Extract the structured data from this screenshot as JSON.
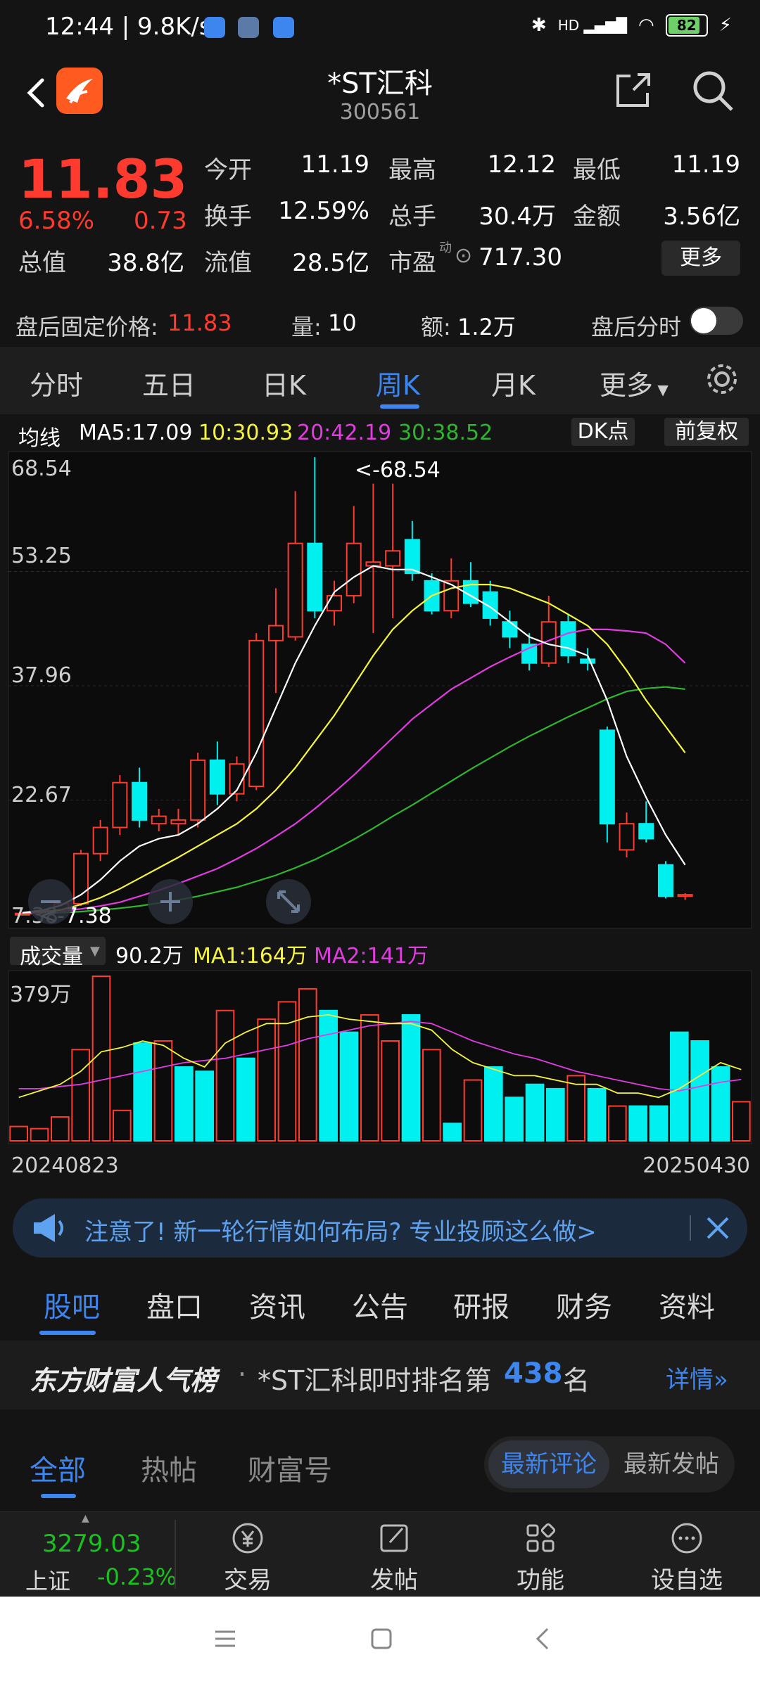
{
  "status": {
    "time": "12:44 | 9.8K/s",
    "battery": "82",
    "net": "HD"
  },
  "header": {
    "title": "*ST汇科",
    "code": "300561"
  },
  "quote": {
    "price": "11.83",
    "pct": "6.58%",
    "change": "0.73",
    "open_label": "今开",
    "open": "11.19",
    "high_label": "最高",
    "high": "12.12",
    "low_label": "最低",
    "low": "11.19",
    "turnover_label": "换手",
    "turnover": "12.59%",
    "vol_label": "总手",
    "vol": "30.4万",
    "amount_label": "金额",
    "amount": "3.56亿",
    "mktcap_label": "总值",
    "mktcap": "38.8亿",
    "float_label": "流值",
    "float": "28.5亿",
    "pe_label": "市盈",
    "pe_sup": "动",
    "pe": "717.30",
    "more": "更多",
    "after_label": "盘后固定价格:",
    "after_price": "11.83",
    "after_vol_label": "量:",
    "after_vol": "10",
    "after_amt_label": "额:",
    "after_amt": "1.2万",
    "after_toggle_label": "盘后分时"
  },
  "period_tabs": [
    "分时",
    "五日",
    "日K",
    "周K",
    "月K",
    "更多"
  ],
  "ma": {
    "label": "均线",
    "ma5": "MA5:17.09",
    "ma10": "10:30.93",
    "ma20": "20:42.19",
    "ma30": "30:38.52",
    "dk": "DK点",
    "adj": "前复权"
  },
  "axis": {
    "y": [
      "68.54",
      "53.25",
      "37.96",
      "22.67",
      "7.38"
    ],
    "max_ann": "<-68.54",
    "min_ann": "<-7.38",
    "vol_max": "379万"
  },
  "volume": {
    "label": "成交量",
    "value": "90.2万",
    "ma1": "MA1:164万",
    "ma2": "MA2:141万"
  },
  "dates": {
    "start": "20240823",
    "end": "20250430"
  },
  "banner": {
    "text": "注意了! 新一轮行情如何布局? 专业投顾这么做>"
  },
  "content_tabs": [
    "股吧",
    "盘口",
    "资讯",
    "公告",
    "研报",
    "财务",
    "资料"
  ],
  "rank": {
    "brand": "东方财富人气榜",
    "text": "*ST汇科即时排名第",
    "num": "438",
    "suffix": "名",
    "detail": "详情"
  },
  "sub_tabs": [
    "全部",
    "热帖",
    "财富号"
  ],
  "sort": {
    "on": "最新评论",
    "off": "最新发帖"
  },
  "bottom": {
    "index_value": "3279.03",
    "index_name": "上证",
    "index_change": "-0.23%",
    "trade": "交易",
    "post": "发帖",
    "func": "功能",
    "watch": "设自选"
  },
  "colors": {
    "up": "#ff3b30",
    "down": "#00f0f0",
    "accent": "#3d86f0",
    "ma5": "#ffffff",
    "ma10": "#f5f53c",
    "ma20": "#e03ce0",
    "ma30": "#2fb52f"
  },
  "chart_data": {
    "type": "candlestick",
    "ylim": [
      7.38,
      68.54
    ],
    "candles": [
      {
        "o": 7.4,
        "h": 7.6,
        "l": 7.38,
        "c": 7.5
      },
      {
        "o": 7.5,
        "h": 8.0,
        "l": 7.4,
        "c": 7.9
      },
      {
        "o": 7.9,
        "h": 9.0,
        "l": 7.7,
        "c": 8.8
      },
      {
        "o": 8.8,
        "h": 16.0,
        "l": 8.5,
        "c": 15.5
      },
      {
        "o": 15.5,
        "h": 20.0,
        "l": 14.5,
        "c": 19.0
      },
      {
        "o": 19.0,
        "h": 26.0,
        "l": 18.0,
        "c": 25.0
      },
      {
        "o": 25.0,
        "h": 27.0,
        "l": 19.0,
        "c": 20.0
      },
      {
        "o": 19.5,
        "h": 21.5,
        "l": 18.5,
        "c": 20.5
      },
      {
        "o": 19.5,
        "h": 21.5,
        "l": 18.0,
        "c": 20.0
      },
      {
        "o": 20.0,
        "h": 29.0,
        "l": 19.0,
        "c": 28.0
      },
      {
        "o": 28.0,
        "h": 30.5,
        "l": 22.0,
        "c": 23.5
      },
      {
        "o": 23.5,
        "h": 28.5,
        "l": 22.5,
        "c": 27.5
      },
      {
        "o": 24.5,
        "h": 45.0,
        "l": 24.0,
        "c": 44.0
      },
      {
        "o": 44.0,
        "h": 51.0,
        "l": 37.0,
        "c": 46.0
      },
      {
        "o": 44.5,
        "h": 64.0,
        "l": 44.0,
        "c": 57.0
      },
      {
        "o": 57.0,
        "h": 68.54,
        "l": 47.0,
        "c": 48.0
      },
      {
        "o": 48.0,
        "h": 52.0,
        "l": 46.0,
        "c": 50.0
      },
      {
        "o": 50.0,
        "h": 62.0,
        "l": 49.0,
        "c": 57.0
      },
      {
        "o": 54.0,
        "h": 65.0,
        "l": 45.0,
        "c": 54.5
      },
      {
        "o": 54.0,
        "h": 65.0,
        "l": 47.0,
        "c": 56.0
      },
      {
        "o": 57.5,
        "h": 60.0,
        "l": 52.0,
        "c": 53.0
      },
      {
        "o": 52.0,
        "h": 53.0,
        "l": 47.5,
        "c": 48.0
      },
      {
        "o": 48.0,
        "h": 55.0,
        "l": 47.0,
        "c": 52.0
      },
      {
        "o": 52.0,
        "h": 54.5,
        "l": 48.5,
        "c": 49.0
      },
      {
        "o": 50.5,
        "h": 52.0,
        "l": 46.0,
        "c": 47.0
      },
      {
        "o": 46.5,
        "h": 48.0,
        "l": 43.0,
        "c": 44.5
      },
      {
        "o": 43.5,
        "h": 45.0,
        "l": 40.0,
        "c": 41.0
      },
      {
        "o": 41.0,
        "h": 50.0,
        "l": 40.5,
        "c": 46.5
      },
      {
        "o": 46.5,
        "h": 47.5,
        "l": 41.0,
        "c": 42.0
      },
      {
        "o": 41.5,
        "h": 43.0,
        "l": 40.0,
        "c": 41.0
      },
      {
        "o": 32.0,
        "h": 32.5,
        "l": 17.0,
        "c": 19.5
      },
      {
        "o": 16.0,
        "h": 21.0,
        "l": 15.0,
        "c": 19.5
      },
      {
        "o": 19.5,
        "h": 22.5,
        "l": 17.0,
        "c": 17.5
      },
      {
        "o": 14.0,
        "h": 14.5,
        "l": 9.5,
        "c": 9.8
      },
      {
        "o": 9.8,
        "h": 10.2,
        "l": 9.3,
        "c": 10.0
      }
    ],
    "ma5": [
      7.6,
      7.9,
      8.6,
      10.0,
      12.0,
      14.5,
      16.5,
      17.5,
      18.0,
      19.5,
      21.5,
      24.0,
      29.0,
      35.0,
      41.0,
      46.0,
      50.5,
      52.5,
      54.0,
      53.5,
      53.5,
      52.5,
      51.5,
      50.0,
      48.5,
      46.5,
      44.5,
      43.5,
      43.0,
      42.0,
      36.0,
      28.5,
      23.0,
      18.0,
      14.0
    ],
    "ma10": [
      7.6,
      7.7,
      8.0,
      8.7,
      9.6,
      10.8,
      12.2,
      13.6,
      15.0,
      16.5,
      18.0,
      19.5,
      21.5,
      24.0,
      27.0,
      30.5,
      34.0,
      38.0,
      42.0,
      45.5,
      48.0,
      50.0,
      51.0,
      51.5,
      51.5,
      51.0,
      50.0,
      49.0,
      47.5,
      46.0,
      43.5,
      40.0,
      36.0,
      32.5,
      29.0
    ],
    "ma20": [
      7.5,
      7.6,
      7.8,
      8.1,
      8.5,
      9.0,
      9.8,
      10.6,
      11.5,
      12.5,
      13.5,
      14.8,
      16.2,
      17.8,
      19.5,
      21.5,
      23.7,
      26.0,
      28.5,
      31.0,
      33.5,
      35.5,
      37.5,
      39.0,
      40.5,
      41.8,
      43.0,
      44.0,
      45.0,
      45.5,
      45.5,
      45.3,
      45.0,
      43.5,
      41.0
    ],
    "ma30": [
      7.45,
      7.5,
      7.6,
      7.75,
      7.95,
      8.2,
      8.5,
      8.9,
      9.3,
      9.8,
      10.4,
      11.0,
      11.8,
      12.6,
      13.6,
      14.7,
      16.0,
      17.4,
      18.9,
      20.5,
      22.0,
      23.6,
      25.2,
      26.8,
      28.3,
      29.8,
      31.2,
      32.5,
      33.8,
      35.0,
      36.2,
      37.2,
      37.6,
      37.8,
      37.5
    ],
    "vol_max": 379,
    "volumes": [
      33,
      28,
      55,
      210,
      379,
      70,
      225,
      230,
      170,
      160,
      300,
      190,
      280,
      320,
      350,
      300,
      250,
      290,
      230,
      290,
      210,
      40,
      140,
      170,
      100,
      130,
      120,
      150,
      120,
      80,
      80,
      80,
      250,
      230,
      170,
      90
    ],
    "vol_up": [
      true,
      true,
      true,
      true,
      true,
      true,
      false,
      true,
      false,
      false,
      true,
      false,
      true,
      true,
      true,
      false,
      false,
      true,
      true,
      false,
      true,
      false,
      true,
      false,
      false,
      false,
      false,
      true,
      false,
      true,
      false,
      false,
      false,
      false,
      false,
      true
    ],
    "vol_ma1": [
      100,
      115,
      130,
      160,
      205,
      215,
      230,
      220,
      190,
      170,
      225,
      250,
      270,
      270,
      285,
      290,
      280,
      275,
      270,
      270,
      255,
      210,
      180,
      165,
      150,
      150,
      140,
      130,
      130,
      110,
      110,
      100,
      120,
      150,
      180,
      164
    ],
    "vol_ma2": [
      120,
      120,
      125,
      130,
      140,
      150,
      160,
      170,
      180,
      185,
      190,
      200,
      210,
      220,
      235,
      245,
      255,
      265,
      270,
      275,
      270,
      250,
      230,
      215,
      200,
      190,
      175,
      160,
      150,
      140,
      130,
      120,
      115,
      125,
      135,
      141
    ]
  }
}
